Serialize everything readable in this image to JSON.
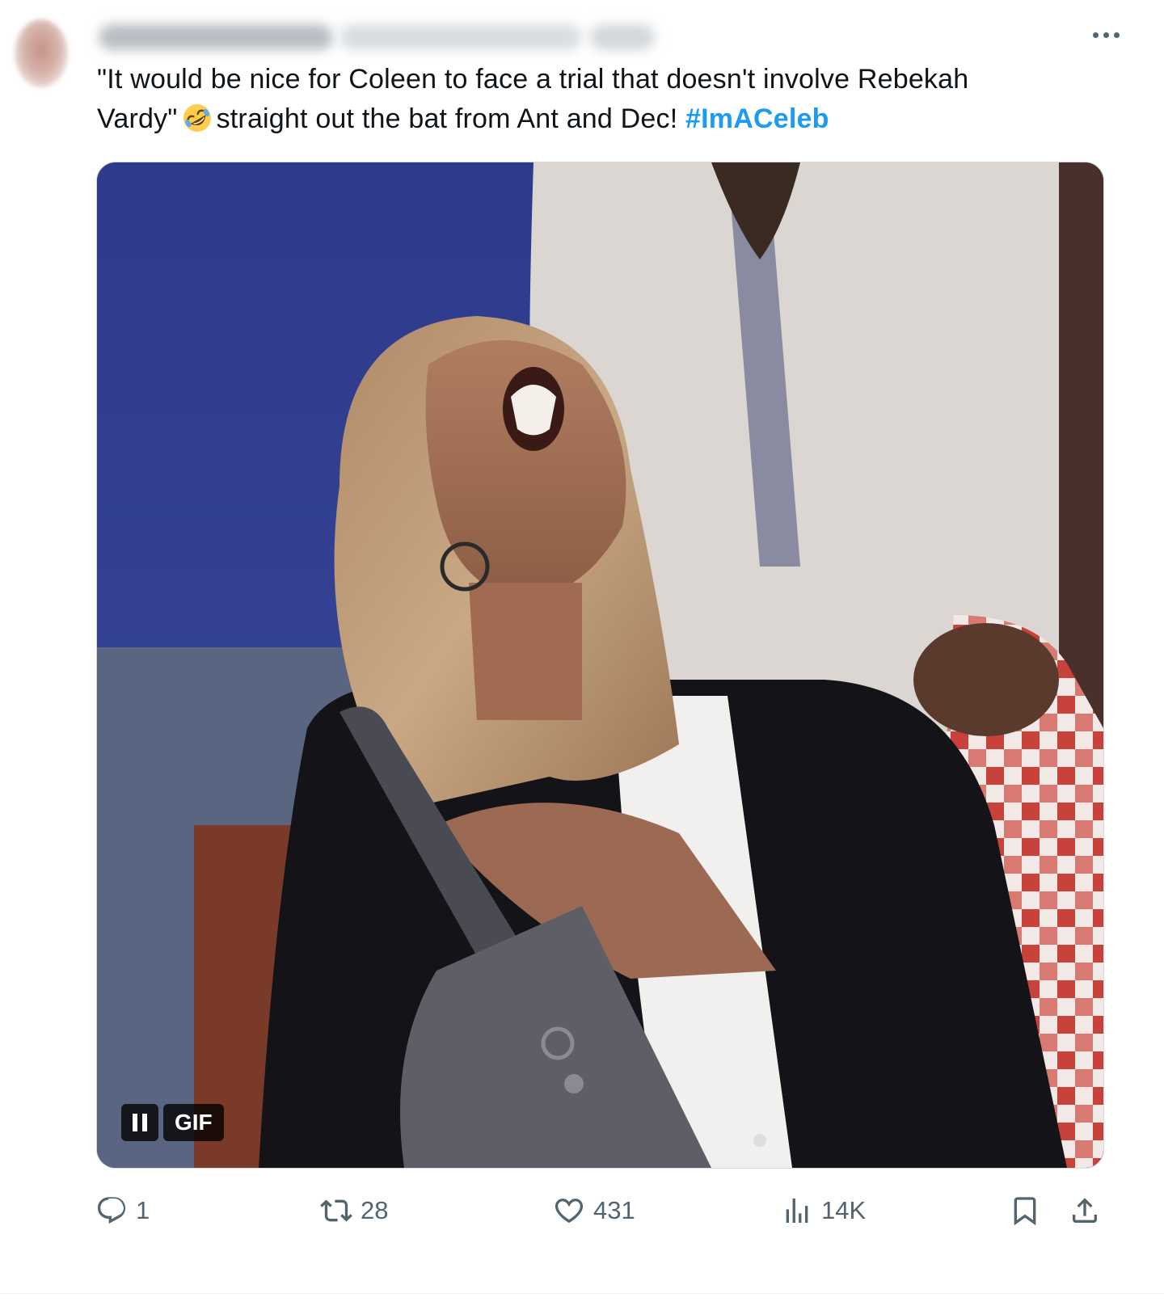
{
  "tweet": {
    "author": {
      "display_name": "",
      "handle": "",
      "timestamp": ""
    },
    "text": {
      "line1": "\"It would be nice for Coleen to face a trial that doesn't involve Rebekah",
      "line2_before_emoji": "Vardy\"",
      "emoji": "rolling-on-the-floor-laughing-emoji",
      "line2_after_emoji": "straight out the bat from Ant and Dec!",
      "hashtag": "#ImACeleb"
    },
    "media": {
      "type": "gif",
      "badge_label": "GIF",
      "pause_icon": "pause-icon"
    },
    "actions": {
      "replies": "1",
      "retweets": "28",
      "likes": "431",
      "views": "14K"
    },
    "colors": {
      "text": "#0f1419",
      "secondary": "#536471",
      "hashtag": "#1d9bf0",
      "border": "#cfd9de"
    }
  }
}
